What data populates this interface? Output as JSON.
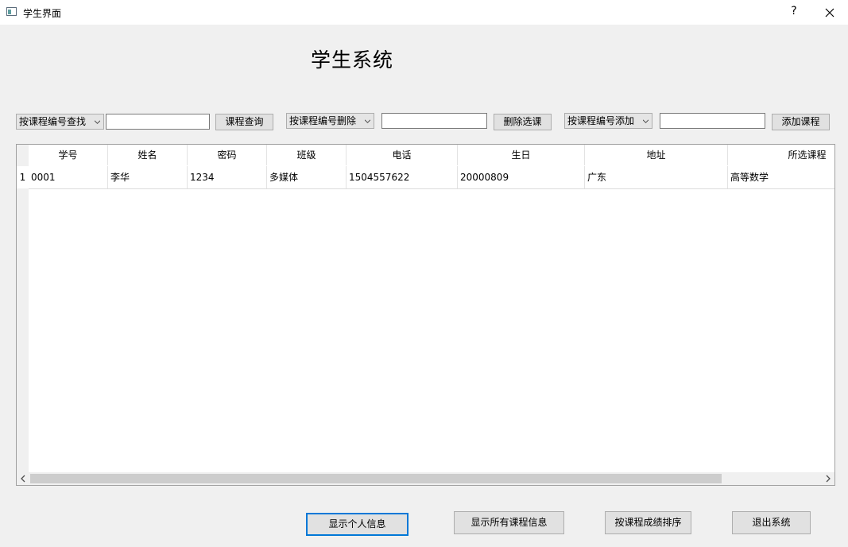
{
  "window": {
    "title": "学生界面",
    "help_label": "?"
  },
  "heading": "学生系统",
  "search_bar": {
    "find": {
      "mode": "按课程编号查找",
      "input_value": "",
      "button_label": "课程查询"
    },
    "delete": {
      "mode": "按课程编号删除",
      "input_value": "",
      "button_label": "删除选课"
    },
    "add": {
      "mode": "按课程编号添加",
      "input_value": "",
      "button_label": "添加课程"
    }
  },
  "table": {
    "columns": [
      "学号",
      "姓名",
      "密码",
      "班级",
      "电话",
      "生日",
      "地址",
      "所选课程"
    ],
    "row_numbers": [
      "1"
    ],
    "rows": [
      [
        "0001",
        "李华",
        "1234",
        "多媒体",
        "1504557622",
        "20000809",
        "广东",
        "高等数学"
      ]
    ]
  },
  "bottom_buttons": {
    "show_personal": "显示个人信息",
    "show_all_courses": "显示所有课程信息",
    "sort_by_score": "按课程成绩排序",
    "exit": "退出系统"
  },
  "colors": {
    "background": "#f0f0f0",
    "focus_border": "#0078d7"
  }
}
